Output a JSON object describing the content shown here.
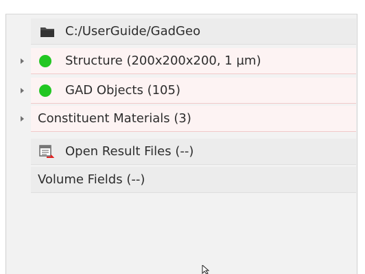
{
  "tree": {
    "root": {
      "icon": "folder-icon",
      "label": "C:/UserGuide/GadGeo"
    },
    "items": [
      {
        "label": "Structure (200x200x200, 1 µm)",
        "status_color": "#22c722",
        "expandable": true
      },
      {
        "label": "GAD Objects (105)",
        "status_color": "#22c722",
        "expandable": true
      },
      {
        "label": "Constituent Materials (3)",
        "expandable": true
      },
      {
        "label": "Open Result Files (--)",
        "icon": "result-files-icon",
        "expandable": false
      },
      {
        "label": "Volume Fields (--)",
        "expandable": false
      }
    ]
  },
  "colors": {
    "status_ok": "#22c722",
    "row_highlight": "#fdf3f3",
    "row_separator": "#f1c9c9"
  },
  "cursor_icon": "mouse-pointer-icon"
}
